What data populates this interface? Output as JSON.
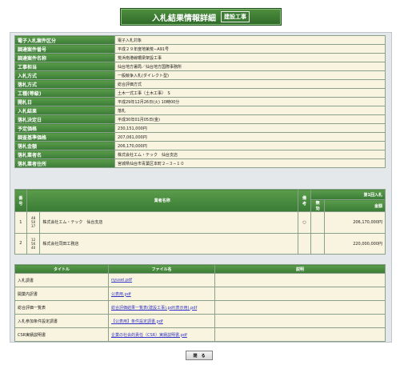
{
  "title": "入札結果情報詳細",
  "title_badge": "建設工事",
  "summary": [
    {
      "label": "電子入札案件区分",
      "value": "電子入札対象"
    },
    {
      "label": "調達案件番号",
      "value": "平成２９年度地第荒−A91号"
    },
    {
      "label": "調達案件名称",
      "value": "荒浜南港線橋梁架設工事"
    },
    {
      "label": "工事担当",
      "value": "仙台地方署局／仙台地方国際事務所"
    },
    {
      "label": "入札方式",
      "value": "一般競争入札(ダイレクト型)"
    },
    {
      "label": "落札方式",
      "value": "総合評価方式"
    },
    {
      "label": "工種(等級)",
      "value": "土木一式工事（土木工事）　S"
    },
    {
      "label": "開札日",
      "value": "平成29年12月26日(火) 10時00分"
    },
    {
      "label": "入札結果",
      "value": "落札"
    },
    {
      "label": "落札決定日",
      "value": "平成30年01月05日(金)"
    },
    {
      "label": "予定価格",
      "value": "230,151,000円"
    },
    {
      "label": "調査基準価格",
      "value": "207,061,000円"
    },
    {
      "label": "落札金額",
      "value": "206,170,000円"
    },
    {
      "label": "落札業者名",
      "value": "株式会社エム・テック　仙台支店"
    },
    {
      "label": "落札業者住所",
      "value": "宮城県仙台市青葉区本町２−３−１０"
    }
  ],
  "results": {
    "headers": {
      "no": "番号",
      "name": "業者名称",
      "remark": "備考",
      "round_group": "第1回入札",
      "amount": "金額",
      "col_a": "辞退",
      "col_b": "無効"
    },
    "rows": [
      {
        "no": "1",
        "code": "48 50 37",
        "name": "株式会社エム・テック　仙台支店",
        "mark": "○",
        "amount": "206,170,000円"
      },
      {
        "no": "2",
        "code": "12 56 40",
        "name": "株式会社同田工務店",
        "mark": "",
        "amount": "220,000,000円"
      }
    ]
  },
  "files": {
    "headers": {
      "title": "タイトル",
      "file": "ファイル名",
      "note": "説明"
    },
    "rows": [
      {
        "title": "入札調書",
        "file": "nyusei.pdf",
        "note": ""
      },
      {
        "title": "開業内訳書",
        "file": "公表用.pdf",
        "note": ""
      },
      {
        "title": "総合評価一覧表",
        "file": "総合評価結果一覧表(建設工事).pdf(表示用).pdf",
        "note": ""
      },
      {
        "title": "入札参加条件設定調書",
        "file": "【公表用】条件設定調書.pdf",
        "note": ""
      },
      {
        "title": "CSR実績説明書",
        "file": "企業の社会的責任（CSR）実績説明書.pdf",
        "note": ""
      }
    ]
  },
  "close_label": "閉　る"
}
